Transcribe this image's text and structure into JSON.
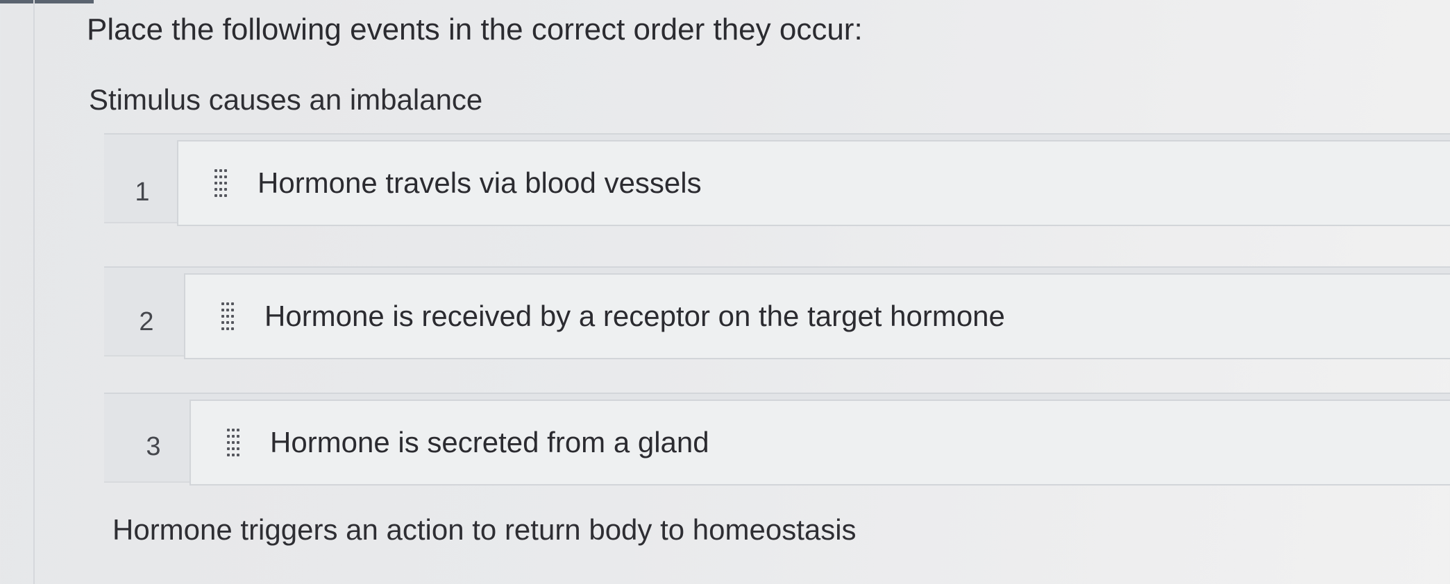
{
  "question": {
    "prompt": "Place the following events in the correct order they occur:"
  },
  "anchors": {
    "first": "Stimulus causes an imbalance",
    "last": "Hormone triggers an action to return body to homeostasis"
  },
  "ordering_items": [
    {
      "position": "1",
      "label": "Hormone travels via blood vessels",
      "icon": "drag-handle-icon"
    },
    {
      "position": "2",
      "label": "Hormone is received by a receptor on the target hormone",
      "icon": "drag-handle-icon"
    },
    {
      "position": "3",
      "label": "Hormone is secreted from a gland",
      "icon": "drag-handle-icon"
    }
  ]
}
